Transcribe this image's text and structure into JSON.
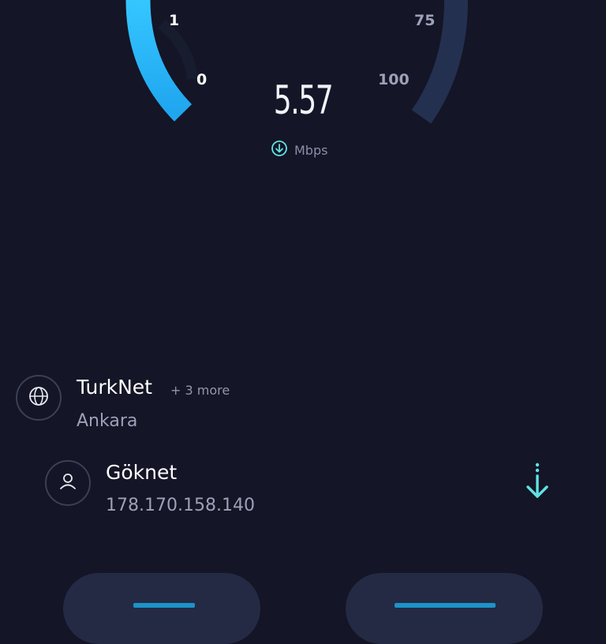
{
  "gauge": {
    "ticks": {
      "t1": "1",
      "t0": "0",
      "t75": "75",
      "t100": "100"
    },
    "speed": "5.57",
    "unit": "Mbps",
    "accent": "#29b8f5",
    "track_color": "#243050"
  },
  "server": {
    "provider": "TurkNet",
    "more": "+ 3 more",
    "city": "Ankara",
    "icon": "globe-icon"
  },
  "client": {
    "isp": "Göknet",
    "ip": "178.170.158.140",
    "icon": "user-icon"
  },
  "download_indicator": {
    "icon": "download-arrow-icon",
    "color": "#5fe3e3"
  },
  "colors": {
    "background": "#141526",
    "text_muted": "#9da1b8",
    "button_bg": "#242a44"
  }
}
